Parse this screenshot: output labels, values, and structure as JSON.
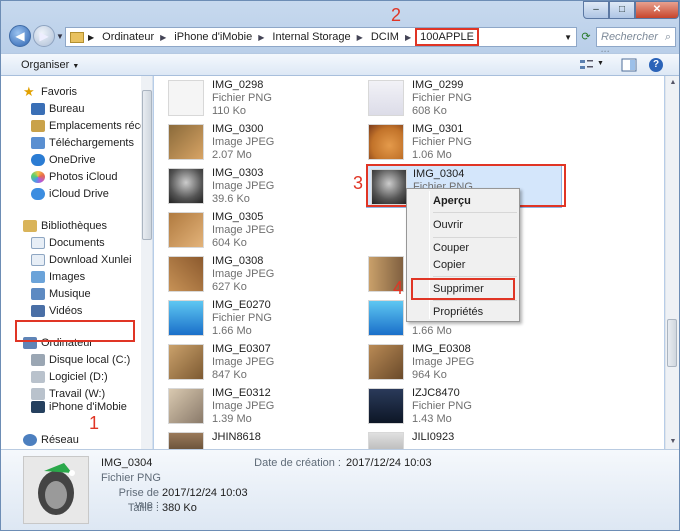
{
  "window": {
    "controls": {
      "minimize": "–",
      "maximize": "□",
      "close": "✕"
    }
  },
  "address": {
    "crumbs": [
      "Ordinateur",
      "iPhone d'iMobie",
      "Internal Storage",
      "DCIM",
      "100APPLE"
    ],
    "search_placeholder": "Rechercher ..."
  },
  "toolbar": {
    "organize_label": "Organiser",
    "help": "?"
  },
  "nav": {
    "favorites_header": "Favoris",
    "favorites": [
      "Bureau",
      "Emplacements récents",
      "Téléchargements",
      "OneDrive",
      "Photos iCloud",
      "iCloud Drive"
    ],
    "libraries_header": "Bibliothèques",
    "libraries": [
      "Documents",
      "Download Xunlei",
      "Images",
      "Musique",
      "Vidéos"
    ],
    "computer_header": "Ordinateur",
    "computer": [
      "Disque local (C:)",
      "Logiciel (D:)",
      "Travail (W:)",
      "iPhone d'iMobie"
    ],
    "network_header": "Réseau"
  },
  "files": [
    {
      "name": "IMG_0298",
      "type": "Fichier PNG",
      "size": "110 Ko"
    },
    {
      "name": "IMG_0299",
      "type": "Fichier PNG",
      "size": "608 Ko"
    },
    {
      "name": "IMG_0300",
      "type": "Image JPEG",
      "size": "2.07 Mo"
    },
    {
      "name": "IMG_0301",
      "type": "Fichier PNG",
      "size": "1.06 Mo"
    },
    {
      "name": "IMG_0303",
      "type": "Image JPEG",
      "size": "39.6 Ko"
    },
    {
      "name": "IMG_0304",
      "type": "Fichier PNG",
      "size": ""
    },
    {
      "name": "IMG_0305",
      "type": "Image JPEG",
      "size": "604 Ko"
    },
    {
      "name": "",
      "type": "",
      "size": ""
    },
    {
      "name": "IMG_0308",
      "type": "Image JPEG",
      "size": "627 Ko"
    },
    {
      "name": "",
      "type": "",
      "size": ""
    },
    {
      "name": "IMG_E0270",
      "type": "Fichier PNG",
      "size": "1.66 Mo"
    },
    {
      "name": "",
      "type": "",
      "size": "1.66 Mo"
    },
    {
      "name": "IMG_E0307",
      "type": "Image JPEG",
      "size": "847 Ko"
    },
    {
      "name": "IMG_E0308",
      "type": "Image JPEG",
      "size": "964 Ko"
    },
    {
      "name": "IMG_E0312",
      "type": "Image JPEG",
      "size": "1.39 Mo"
    },
    {
      "name": "IZJC8470",
      "type": "Fichier PNG",
      "size": "1.43 Mo"
    },
    {
      "name": "JHIN8618",
      "type": "",
      "size": ""
    },
    {
      "name": "JILI0923",
      "type": "",
      "size": ""
    }
  ],
  "context_menu": {
    "items": [
      "Aperçu",
      "Ouvrir",
      "Couper",
      "Copier",
      "Supprimer",
      "Propriétés"
    ]
  },
  "annotations": [
    "1",
    "2",
    "3",
    "4"
  ],
  "details": {
    "name": "IMG_0304",
    "type": "Fichier PNG",
    "taken_label": "Prise de vue :",
    "taken_value": "2017/12/24 10:03",
    "size_label": "Taille :",
    "size_value": "380 Ko",
    "created_label": "Date de création :",
    "created_value": "2017/12/24 10:03"
  },
  "colors": {
    "highlight": "#e03525",
    "selection": "#d4e6fb"
  }
}
